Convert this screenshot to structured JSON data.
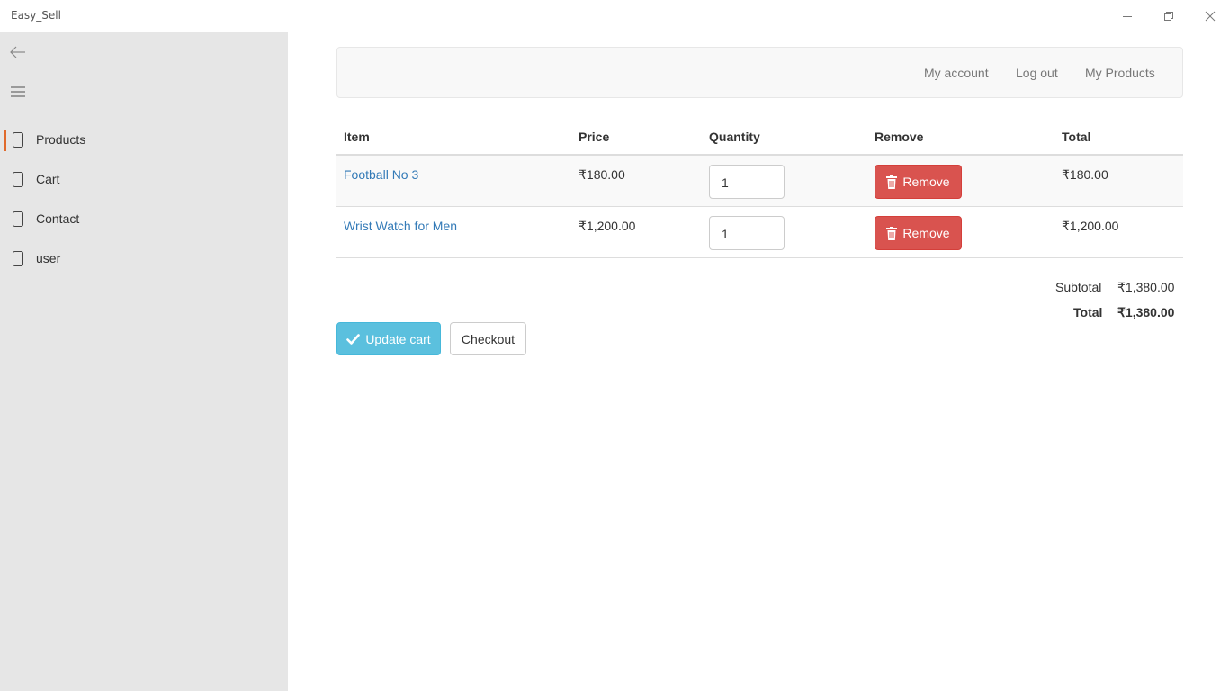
{
  "window": {
    "title": "Easy_Sell",
    "controls": [
      "minimize-icon",
      "restore-icon",
      "close-icon"
    ]
  },
  "sidebar": {
    "back_icon": "back-arrow-icon",
    "menu_icon": "hamburger-icon",
    "items": [
      {
        "label": "Products",
        "icon": "page-icon",
        "selected": true
      },
      {
        "label": "Cart",
        "icon": "page-icon",
        "selected": false
      },
      {
        "label": "Contact",
        "icon": "page-icon",
        "selected": false
      },
      {
        "label": "user",
        "icon": "page-icon",
        "selected": false
      }
    ],
    "accent": "#e06a2c"
  },
  "topnav": {
    "links": [
      "My account",
      "Log out",
      "My Products"
    ]
  },
  "cart": {
    "headers": [
      "Item",
      "Price",
      "Quantity",
      "Remove",
      "Total"
    ],
    "rows": [
      {
        "item": "Football No 3",
        "price": "₹180.00",
        "quantity": "1",
        "remove_label": "Remove",
        "total": "₹180.00"
      },
      {
        "item": "Wrist Watch for Men",
        "price": "₹1,200.00",
        "quantity": "1",
        "remove_label": "Remove",
        "total": "₹1,200.00"
      }
    ],
    "subtotal_label": "Subtotal",
    "subtotal_value": "₹1,380.00",
    "total_label": "Total",
    "total_value": "₹1,380.00"
  },
  "actions": {
    "update_label": "Update cart",
    "checkout_label": "Checkout"
  },
  "colors": {
    "link": "#337ab7",
    "danger": "#d9534f",
    "info": "#5bc0de"
  }
}
